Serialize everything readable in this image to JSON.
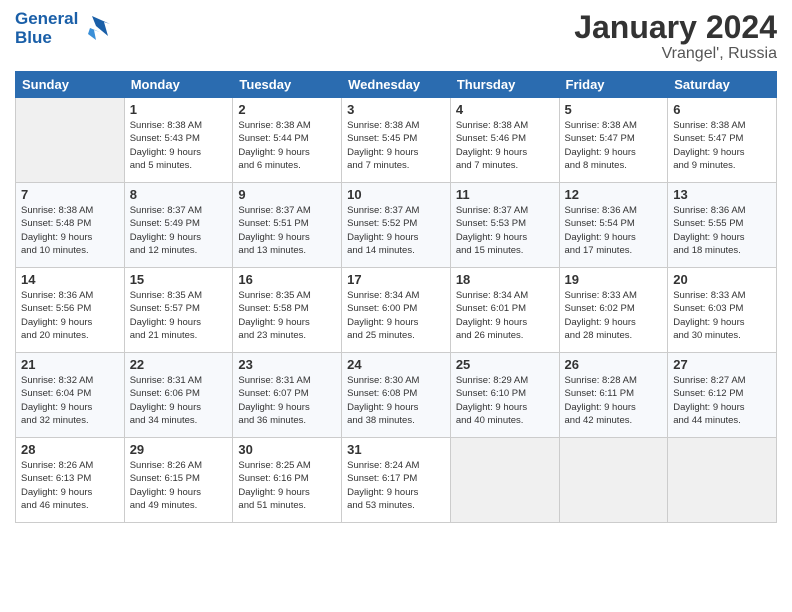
{
  "logo": {
    "line1": "General",
    "line2": "Blue"
  },
  "title": "January 2024",
  "location": "Vrangel', Russia",
  "days_of_week": [
    "Sunday",
    "Monday",
    "Tuesday",
    "Wednesday",
    "Thursday",
    "Friday",
    "Saturday"
  ],
  "weeks": [
    [
      {
        "day": "",
        "info": ""
      },
      {
        "day": "1",
        "info": "Sunrise: 8:38 AM\nSunset: 5:43 PM\nDaylight: 9 hours\nand 5 minutes."
      },
      {
        "day": "2",
        "info": "Sunrise: 8:38 AM\nSunset: 5:44 PM\nDaylight: 9 hours\nand 6 minutes."
      },
      {
        "day": "3",
        "info": "Sunrise: 8:38 AM\nSunset: 5:45 PM\nDaylight: 9 hours\nand 7 minutes."
      },
      {
        "day": "4",
        "info": "Sunrise: 8:38 AM\nSunset: 5:46 PM\nDaylight: 9 hours\nand 7 minutes."
      },
      {
        "day": "5",
        "info": "Sunrise: 8:38 AM\nSunset: 5:47 PM\nDaylight: 9 hours\nand 8 minutes."
      },
      {
        "day": "6",
        "info": "Sunrise: 8:38 AM\nSunset: 5:47 PM\nDaylight: 9 hours\nand 9 minutes."
      }
    ],
    [
      {
        "day": "7",
        "info": "Sunrise: 8:38 AM\nSunset: 5:48 PM\nDaylight: 9 hours\nand 10 minutes."
      },
      {
        "day": "8",
        "info": "Sunrise: 8:37 AM\nSunset: 5:49 PM\nDaylight: 9 hours\nand 12 minutes."
      },
      {
        "day": "9",
        "info": "Sunrise: 8:37 AM\nSunset: 5:51 PM\nDaylight: 9 hours\nand 13 minutes."
      },
      {
        "day": "10",
        "info": "Sunrise: 8:37 AM\nSunset: 5:52 PM\nDaylight: 9 hours\nand 14 minutes."
      },
      {
        "day": "11",
        "info": "Sunrise: 8:37 AM\nSunset: 5:53 PM\nDaylight: 9 hours\nand 15 minutes."
      },
      {
        "day": "12",
        "info": "Sunrise: 8:36 AM\nSunset: 5:54 PM\nDaylight: 9 hours\nand 17 minutes."
      },
      {
        "day": "13",
        "info": "Sunrise: 8:36 AM\nSunset: 5:55 PM\nDaylight: 9 hours\nand 18 minutes."
      }
    ],
    [
      {
        "day": "14",
        "info": "Sunrise: 8:36 AM\nSunset: 5:56 PM\nDaylight: 9 hours\nand 20 minutes."
      },
      {
        "day": "15",
        "info": "Sunrise: 8:35 AM\nSunset: 5:57 PM\nDaylight: 9 hours\nand 21 minutes."
      },
      {
        "day": "16",
        "info": "Sunrise: 8:35 AM\nSunset: 5:58 PM\nDaylight: 9 hours\nand 23 minutes."
      },
      {
        "day": "17",
        "info": "Sunrise: 8:34 AM\nSunset: 6:00 PM\nDaylight: 9 hours\nand 25 minutes."
      },
      {
        "day": "18",
        "info": "Sunrise: 8:34 AM\nSunset: 6:01 PM\nDaylight: 9 hours\nand 26 minutes."
      },
      {
        "day": "19",
        "info": "Sunrise: 8:33 AM\nSunset: 6:02 PM\nDaylight: 9 hours\nand 28 minutes."
      },
      {
        "day": "20",
        "info": "Sunrise: 8:33 AM\nSunset: 6:03 PM\nDaylight: 9 hours\nand 30 minutes."
      }
    ],
    [
      {
        "day": "21",
        "info": "Sunrise: 8:32 AM\nSunset: 6:04 PM\nDaylight: 9 hours\nand 32 minutes."
      },
      {
        "day": "22",
        "info": "Sunrise: 8:31 AM\nSunset: 6:06 PM\nDaylight: 9 hours\nand 34 minutes."
      },
      {
        "day": "23",
        "info": "Sunrise: 8:31 AM\nSunset: 6:07 PM\nDaylight: 9 hours\nand 36 minutes."
      },
      {
        "day": "24",
        "info": "Sunrise: 8:30 AM\nSunset: 6:08 PM\nDaylight: 9 hours\nand 38 minutes."
      },
      {
        "day": "25",
        "info": "Sunrise: 8:29 AM\nSunset: 6:10 PM\nDaylight: 9 hours\nand 40 minutes."
      },
      {
        "day": "26",
        "info": "Sunrise: 8:28 AM\nSunset: 6:11 PM\nDaylight: 9 hours\nand 42 minutes."
      },
      {
        "day": "27",
        "info": "Sunrise: 8:27 AM\nSunset: 6:12 PM\nDaylight: 9 hours\nand 44 minutes."
      }
    ],
    [
      {
        "day": "28",
        "info": "Sunrise: 8:26 AM\nSunset: 6:13 PM\nDaylight: 9 hours\nand 46 minutes."
      },
      {
        "day": "29",
        "info": "Sunrise: 8:26 AM\nSunset: 6:15 PM\nDaylight: 9 hours\nand 49 minutes."
      },
      {
        "day": "30",
        "info": "Sunrise: 8:25 AM\nSunset: 6:16 PM\nDaylight: 9 hours\nand 51 minutes."
      },
      {
        "day": "31",
        "info": "Sunrise: 8:24 AM\nSunset: 6:17 PM\nDaylight: 9 hours\nand 53 minutes."
      },
      {
        "day": "",
        "info": ""
      },
      {
        "day": "",
        "info": ""
      },
      {
        "day": "",
        "info": ""
      }
    ]
  ]
}
